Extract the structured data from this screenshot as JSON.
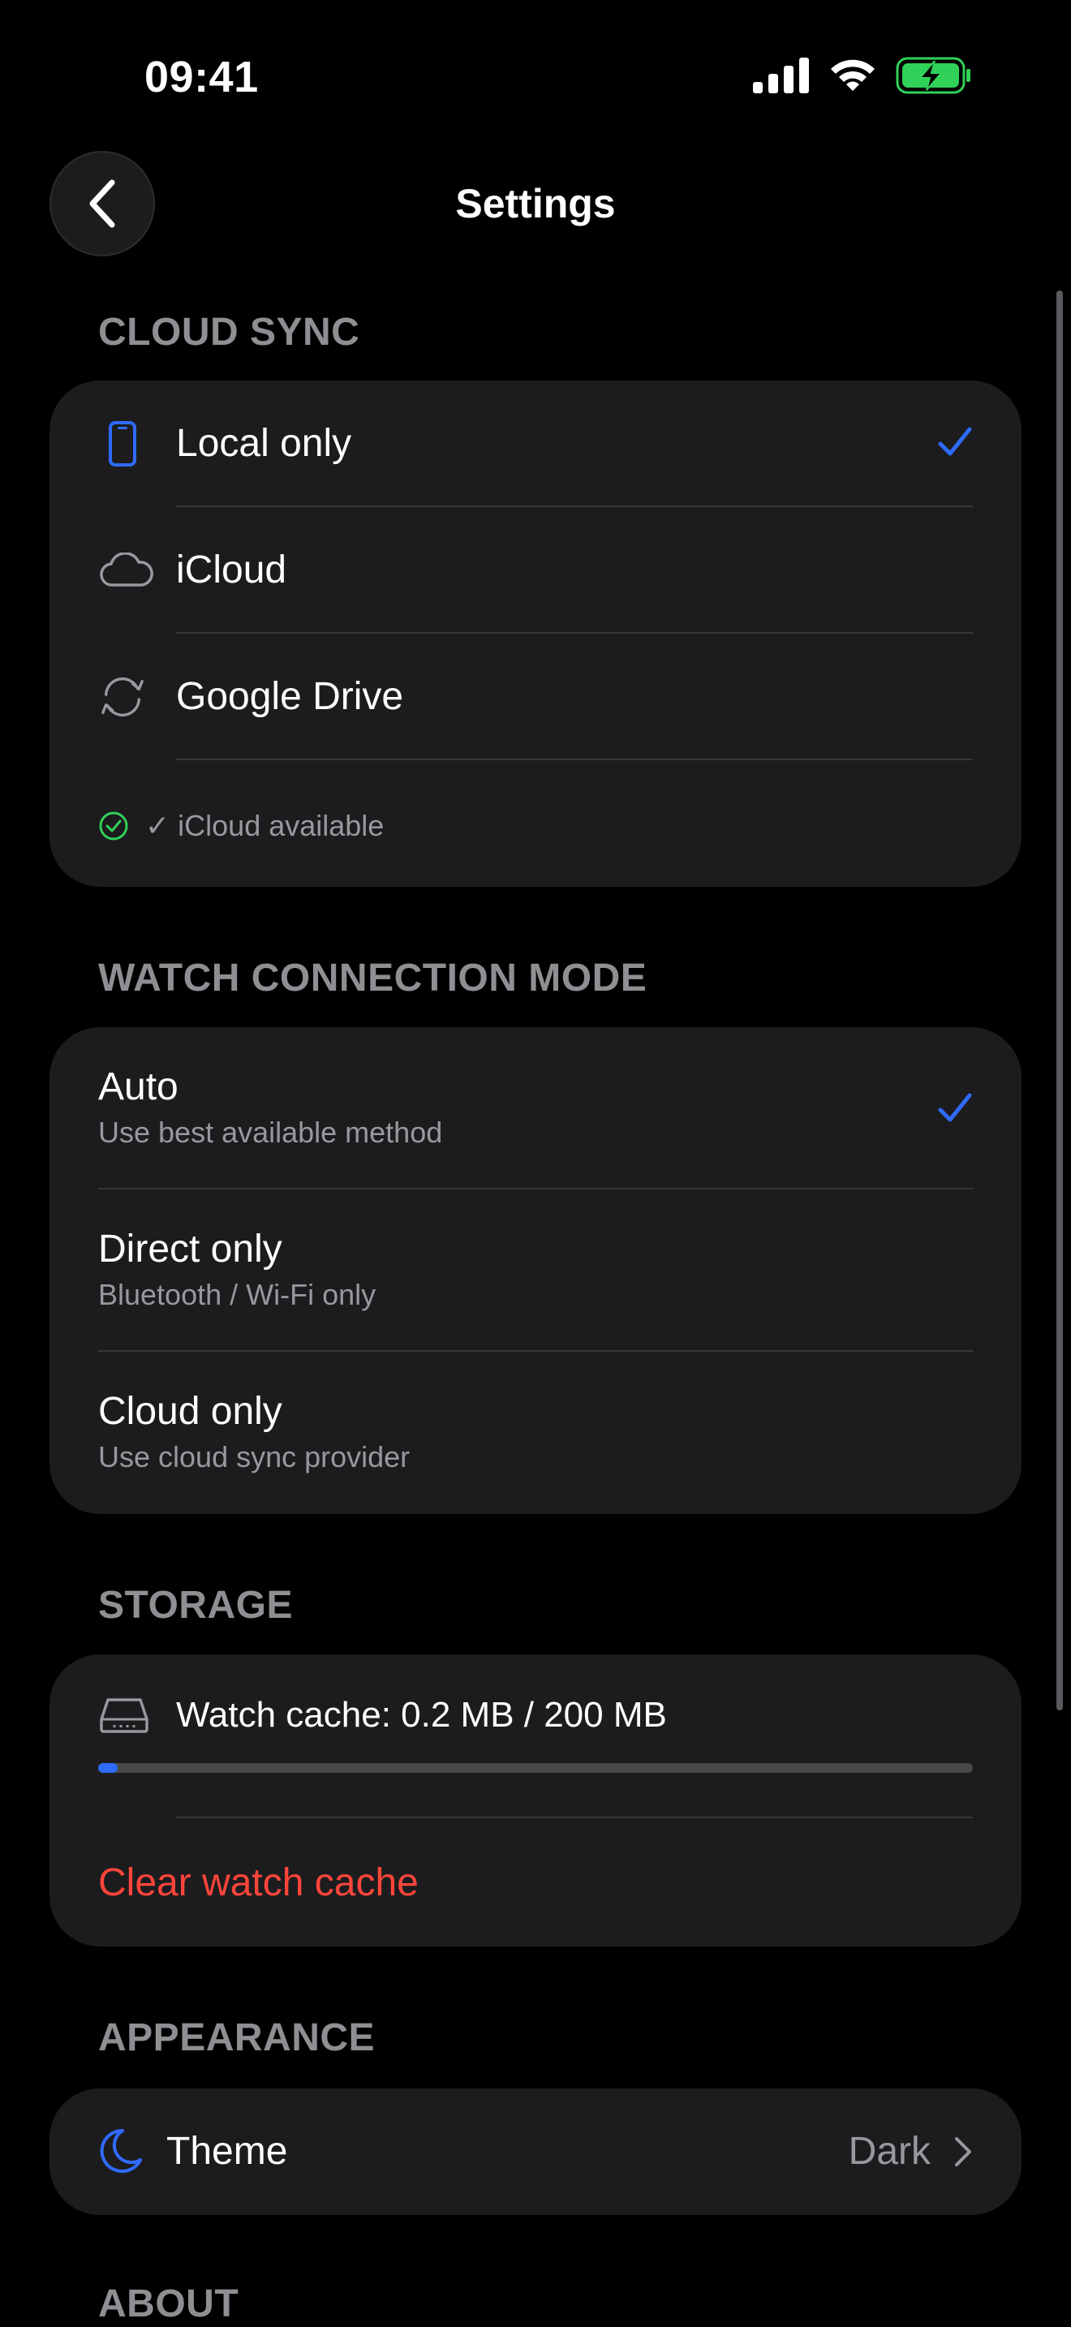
{
  "status_bar": {
    "time": "09:41"
  },
  "nav": {
    "title": "Settings"
  },
  "cloud_sync": {
    "header": "CLOUD SYNC",
    "options": [
      {
        "label": "Local only",
        "icon": "phone-icon",
        "selected": true
      },
      {
        "label": "iCloud",
        "icon": "cloud-icon",
        "selected": false
      },
      {
        "label": "Google Drive",
        "icon": "sync-icon",
        "selected": false
      }
    ],
    "status": "✓ iCloud available"
  },
  "watch_mode": {
    "header": "WATCH CONNECTION MODE",
    "options": [
      {
        "label": "Auto",
        "subtitle": "Use best available method",
        "selected": true
      },
      {
        "label": "Direct only",
        "subtitle": "Bluetooth / Wi-Fi only",
        "selected": false
      },
      {
        "label": "Cloud only",
        "subtitle": "Use cloud sync provider",
        "selected": false
      }
    ]
  },
  "storage": {
    "header": "STORAGE",
    "cache_label": "Watch cache: 0.2 MB / 200 MB",
    "cache_used_fraction": 0.001,
    "clear_label": "Clear watch cache"
  },
  "appearance": {
    "header": "APPEARANCE",
    "theme_label": "Theme",
    "theme_value": "Dark"
  },
  "about": {
    "header": "ABOUT"
  },
  "colors": {
    "accent": "#2f6bff",
    "danger": "#ff453a",
    "success": "#30d158",
    "card": "#1c1c1e",
    "secondary_text": "#98989d"
  }
}
